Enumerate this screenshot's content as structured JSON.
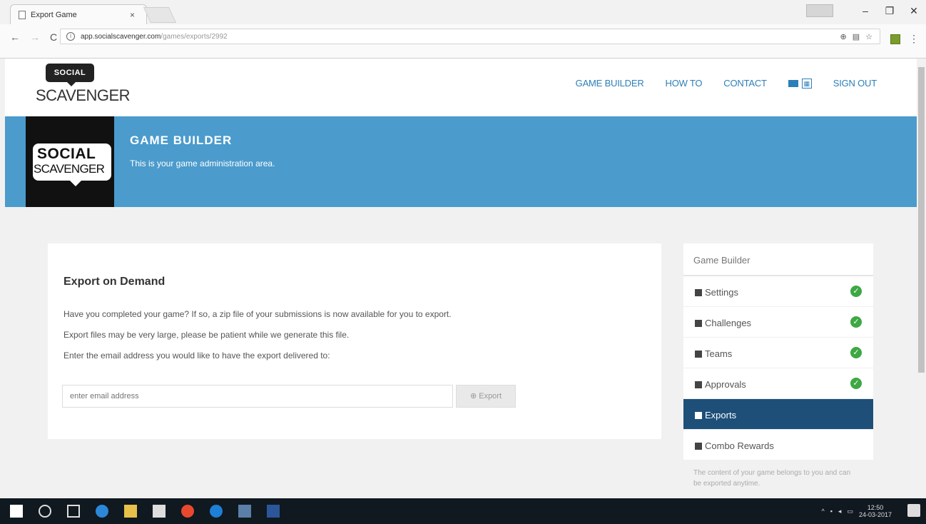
{
  "browser": {
    "tab_title": "Export Game",
    "tab_close": "×",
    "url_host": "app.socialscavenger.com",
    "url_path": "/games/exports/2992",
    "window_buttons": [
      "–",
      "❐",
      "✕"
    ]
  },
  "topnav": {
    "logo_badge": "SOCIAL",
    "logo_word": "SCAVENGER",
    "items": [
      {
        "label": "GAME BUILDER"
      },
      {
        "label": "HOW TO"
      },
      {
        "label": "CONTACT"
      }
    ],
    "sign_out": "SIGN OUT"
  },
  "hero": {
    "logo_top": "SOCIAL",
    "logo_bottom": "SCAVENGER",
    "title": "GAME BUILDER",
    "subtitle": "This is your game administration area."
  },
  "export": {
    "heading": "Export on Demand",
    "line1": "Have you completed your game? If so, a zip file of your submissions is now available for you to export.",
    "line2": "Export files may be very large, please be patient while we generate this file.",
    "line3": "Enter the email address you would like to have the export delivered to:",
    "email_placeholder": "enter email address",
    "button_label": "⊕ Export"
  },
  "sidebar": {
    "title": "Game Builder",
    "items": [
      {
        "label": "Settings",
        "icon": "gear-icon",
        "done": true
      },
      {
        "label": "Challenges",
        "icon": "list-icon",
        "done": true
      },
      {
        "label": "Teams",
        "icon": "user-icon",
        "done": true
      },
      {
        "label": "Approvals",
        "icon": "thumbs-up-icon",
        "done": true
      },
      {
        "label": "Exports",
        "icon": "download-icon",
        "done": false,
        "active": true
      },
      {
        "label": "Combo Rewards",
        "icon": "gift-icon",
        "done": false
      }
    ],
    "note": "The content of your game belongs to you and can be exported anytime."
  },
  "taskbar": {
    "time": "12:50",
    "date": "24-03-2017"
  },
  "colors": {
    "accent": "#4b9bcc",
    "nav_link": "#2d7fb8",
    "active_item": "#1d4f79",
    "check": "#3da844"
  }
}
